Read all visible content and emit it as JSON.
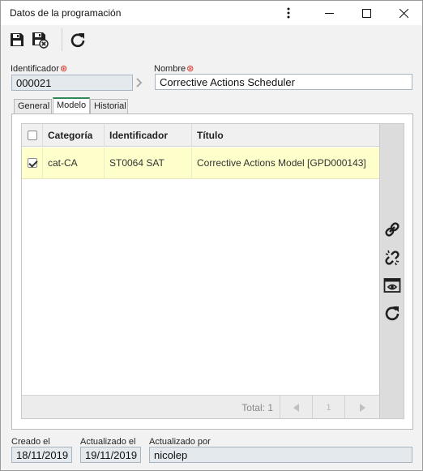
{
  "window": {
    "title": "Datos de la programación",
    "controls": [
      "more-options",
      "minimize",
      "maximize",
      "close"
    ]
  },
  "toolbar": {
    "buttons": [
      {
        "name": "save",
        "icon": "floppy-disk-icon"
      },
      {
        "name": "save-and-close",
        "icon": "floppy-disk-close-icon"
      },
      {
        "name": "refresh",
        "icon": "refresh-icon"
      }
    ]
  },
  "form": {
    "identificador_label": "Identificador",
    "identificador_value": "000021",
    "nombre_label": "Nombre",
    "nombre_value": "Corrective Actions Scheduler",
    "required_marker": "⊛"
  },
  "tabs": [
    {
      "label": "General",
      "active": false
    },
    {
      "label": "Modelo",
      "active": true
    },
    {
      "label": "Historial",
      "active": false
    }
  ],
  "grid": {
    "columns": [
      "Categoría",
      "Identificador",
      "Título"
    ],
    "rows": [
      {
        "checked": true,
        "categoria": "cat-CA",
        "identificador": "ST0064 SAT",
        "titulo": "Corrective Actions Model [GPD000143]"
      }
    ],
    "footer": {
      "total_label": "Total: 1",
      "page": "1"
    }
  },
  "sidebar_actions": [
    {
      "name": "associate",
      "icon": "link-icon"
    },
    {
      "name": "disassociate",
      "icon": "unlink-icon"
    },
    {
      "name": "view",
      "icon": "window-eye-icon"
    },
    {
      "name": "refresh",
      "icon": "refresh-icon"
    }
  ],
  "footer": {
    "creado_label": "Creado el",
    "creado_value": "18/11/2019",
    "actualizado_label": "Actualizado el",
    "actualizado_value": "19/11/2019",
    "actualizado_por_label": "Actualizado por",
    "actualizado_por_value": "nicolep"
  },
  "colors": {
    "selected_row": "#ffffcc",
    "active_tab_accent": "#2e8b57",
    "required": "#d9251c",
    "readonly_field": "#e4e9ee"
  }
}
